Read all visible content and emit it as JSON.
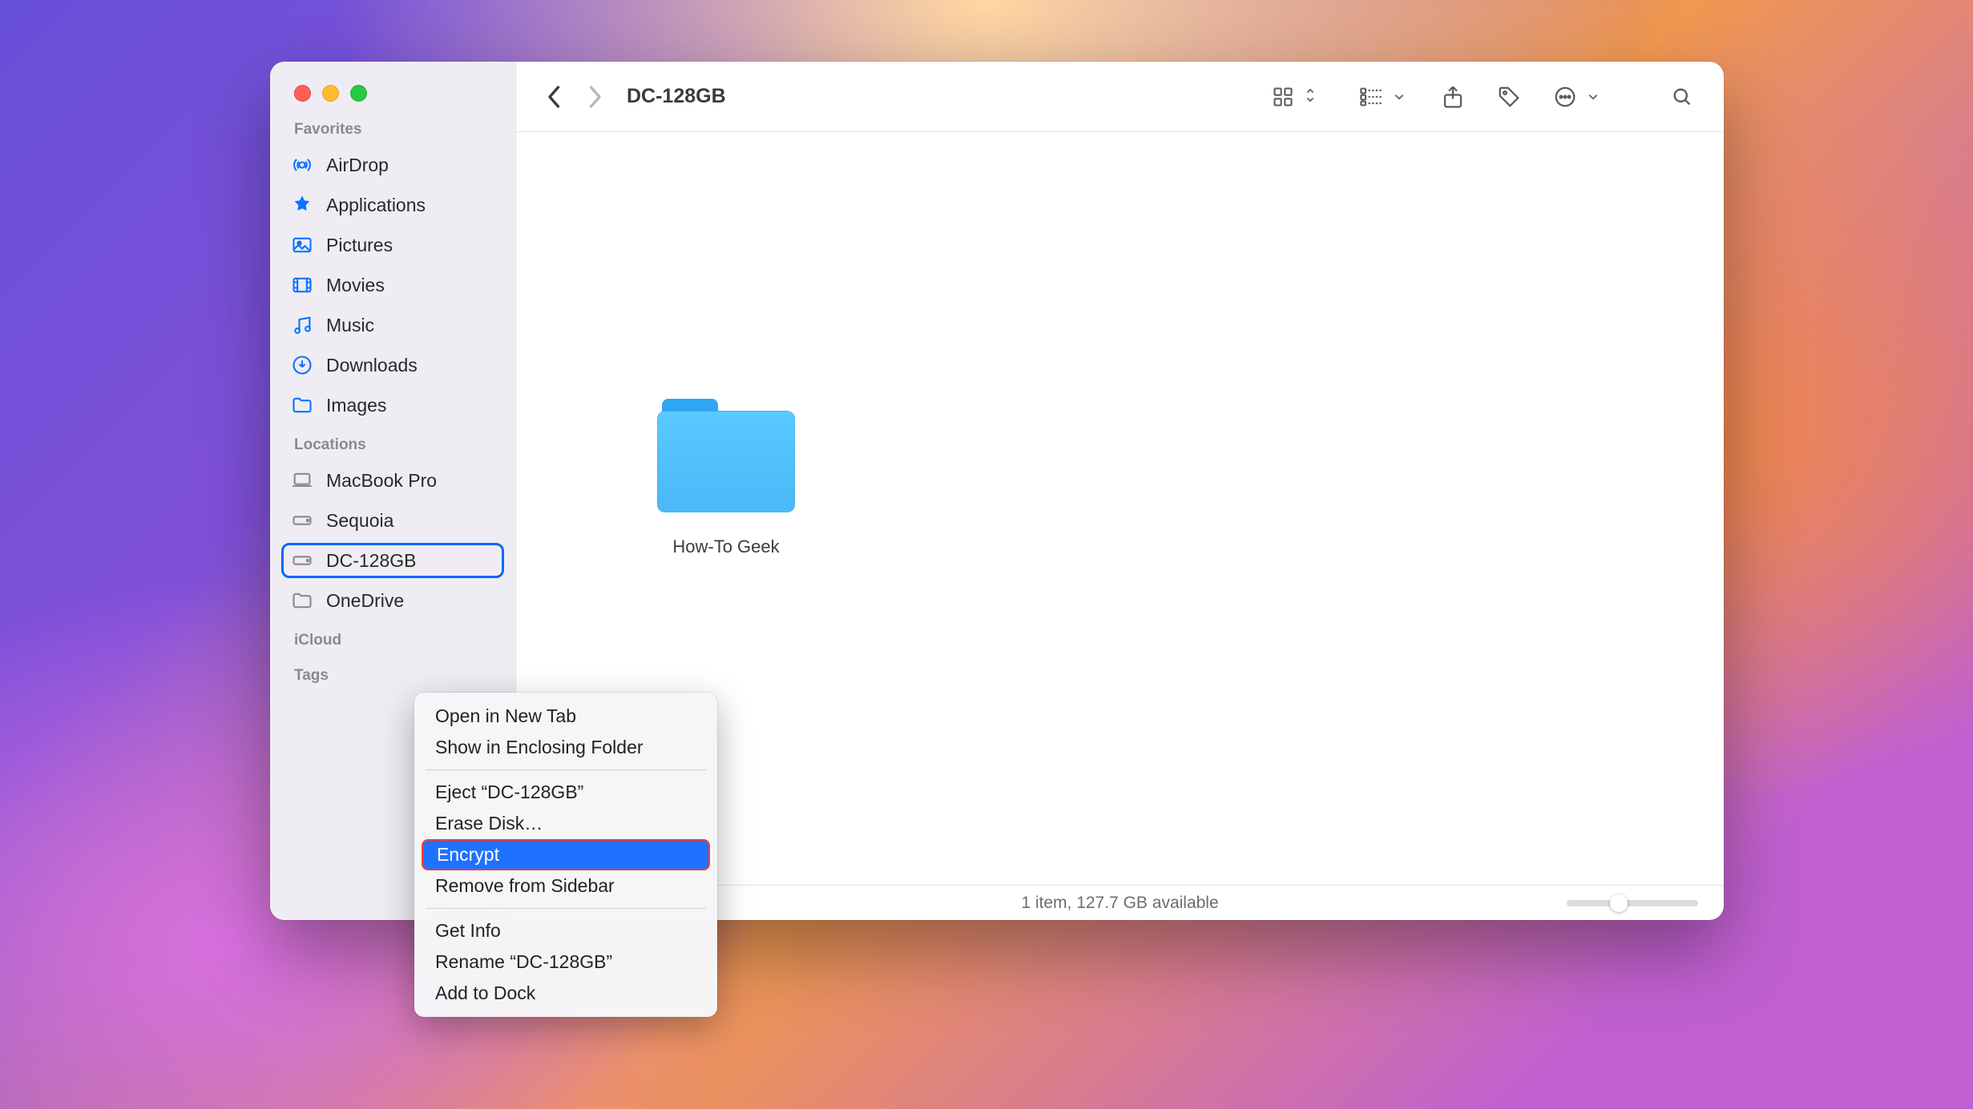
{
  "window": {
    "title": "DC-128GB"
  },
  "sidebar": {
    "sections": {
      "favorites": {
        "label": "Favorites",
        "items": [
          {
            "label": "AirDrop"
          },
          {
            "label": "Applications"
          },
          {
            "label": "Pictures"
          },
          {
            "label": "Movies"
          },
          {
            "label": "Music"
          },
          {
            "label": "Downloads"
          },
          {
            "label": "Images"
          }
        ]
      },
      "locations": {
        "label": "Locations",
        "items": [
          {
            "label": "MacBook Pro"
          },
          {
            "label": "Sequoia"
          },
          {
            "label": "DC-128GB"
          },
          {
            "label": "OneDrive"
          }
        ]
      },
      "icloud": {
        "label": "iCloud"
      },
      "tags": {
        "label": "Tags"
      }
    }
  },
  "content": {
    "items": [
      {
        "name": "How-To Geek"
      }
    ]
  },
  "status": {
    "text": "1 item, 127.7 GB available"
  },
  "contextMenu": {
    "items": {
      "open_tab": "Open in New Tab",
      "show_enclosing": "Show in Enclosing Folder",
      "eject": "Eject “DC-128GB”",
      "erase": "Erase Disk…",
      "encrypt": "Encrypt",
      "remove": "Remove from Sidebar",
      "get_info": "Get Info",
      "rename": "Rename “DC-128GB”",
      "add_dock": "Add to Dock"
    }
  }
}
